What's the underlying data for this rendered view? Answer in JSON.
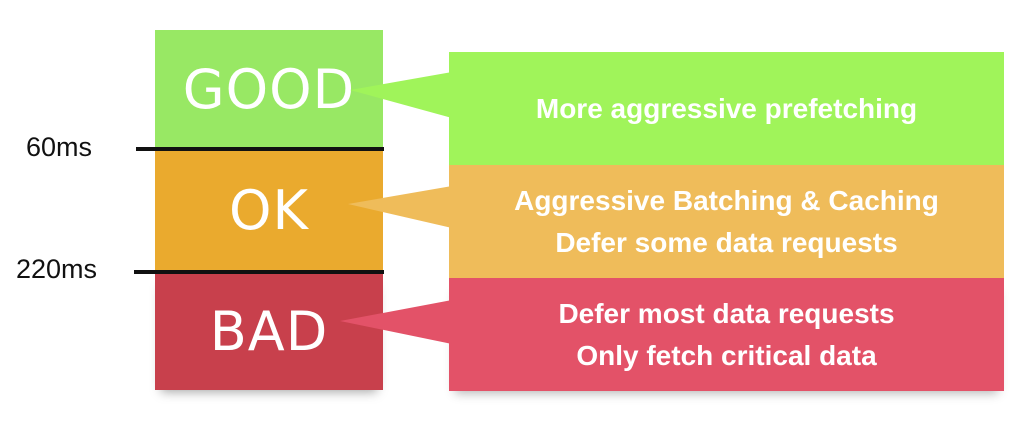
{
  "thresholds": {
    "first": "60ms",
    "second": "220ms"
  },
  "levels": [
    {
      "label": "GOOD",
      "color": "#98e864"
    },
    {
      "label": "OK",
      "color": "#eaaa2e"
    },
    {
      "label": "BAD",
      "color": "#c8404c"
    }
  ],
  "callouts": [
    {
      "lines": [
        "More aggressive prefetching"
      ],
      "color": "#a0f45a"
    },
    {
      "lines": [
        "Aggressive Batching & Caching",
        "Defer some data requests"
      ],
      "color": "#efbc5a"
    },
    {
      "lines": [
        "Defer most data requests",
        "Only fetch critical data"
      ],
      "color": "#e35268"
    }
  ]
}
